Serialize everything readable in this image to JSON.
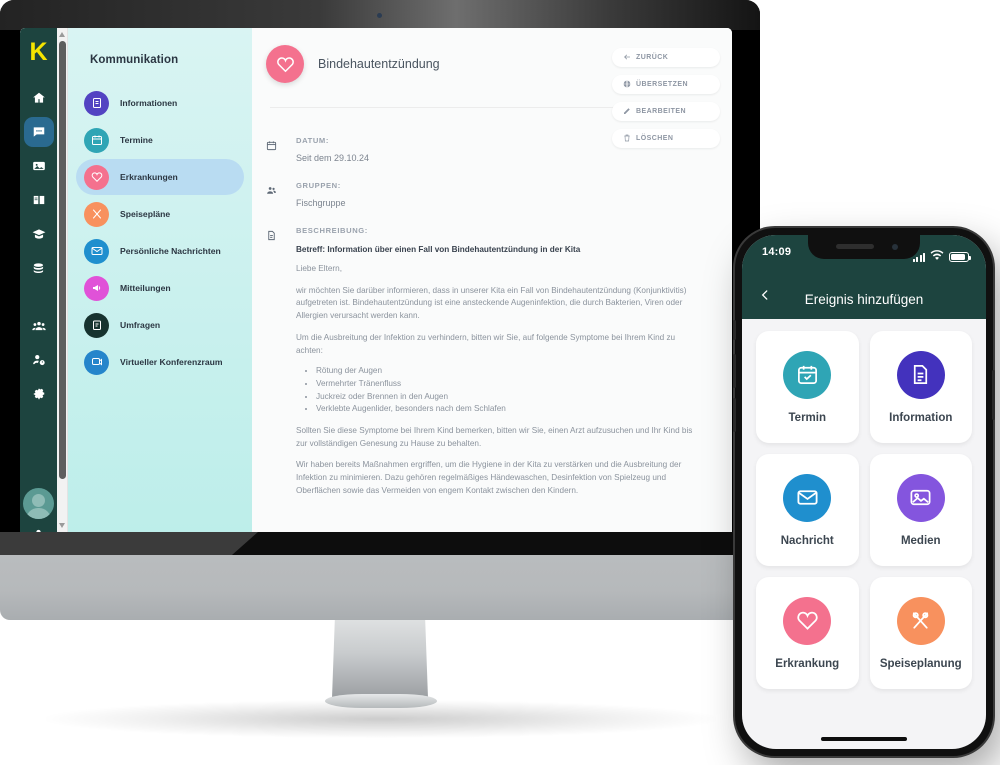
{
  "desktop": {
    "brand_letter": "K",
    "rail_items": [
      {
        "name": "home",
        "icon": "home-icon",
        "active": false
      },
      {
        "name": "communication",
        "icon": "chat-icon",
        "active": true
      },
      {
        "name": "media",
        "icon": "image-icon",
        "active": false
      },
      {
        "name": "documentation",
        "icon": "book-icon",
        "active": false
      },
      {
        "name": "education",
        "icon": "graduation-cap-icon",
        "active": false
      },
      {
        "name": "finance",
        "icon": "coins-icon",
        "active": false
      },
      {
        "name": "groups",
        "icon": "users-icon",
        "active": false
      },
      {
        "name": "staff",
        "icon": "user-clock-icon",
        "active": false
      },
      {
        "name": "settings",
        "icon": "gear-icon",
        "active": false
      }
    ],
    "rail_bottom_icon": "user-icon",
    "menu": {
      "title": "Kommunikation",
      "items": [
        {
          "label": "Informationen",
          "icon": "document-icon",
          "color": "#5243c2",
          "active": false
        },
        {
          "label": "Termine",
          "icon": "calendar-icon",
          "color": "#2fa5b5",
          "active": false
        },
        {
          "label": "Erkrankungen",
          "icon": "heart-pulse-icon",
          "color": "#f4718e",
          "active": true
        },
        {
          "label": "Speisepläne",
          "icon": "cutlery-icon",
          "color": "#f8915e",
          "active": false
        },
        {
          "label": "Persönliche Nachrichten",
          "icon": "envelope-icon",
          "color": "#1f8fce",
          "active": false
        },
        {
          "label": "Mitteilungen",
          "icon": "megaphone-icon",
          "color": "#e052d8",
          "active": false
        },
        {
          "label": "Umfragen",
          "icon": "clipboard-icon",
          "color": "#17332f",
          "active": false
        },
        {
          "label": "Virtueller Konferenzraum",
          "icon": "video-icon",
          "color": "#2585cb",
          "active": false
        }
      ]
    },
    "header": {
      "icon": "heart-pulse-icon",
      "badge_color": "#f4718e",
      "title": "Bindehautentzündung"
    },
    "actions": [
      {
        "label": "ZURÜCK",
        "icon": "arrow-left-icon"
      },
      {
        "label": "ÜBERSETZEN",
        "icon": "globe-icon"
      },
      {
        "label": "BEARBEITEN",
        "icon": "pencil-icon"
      },
      {
        "label": "LÖSCHEN",
        "icon": "trash-icon"
      }
    ],
    "details": [
      {
        "icon": "calendar-icon",
        "label": "DATUM:",
        "value": "Seit dem 29.10.24"
      },
      {
        "icon": "users-icon",
        "label": "GRUPPEN:",
        "value": "Fischgruppe"
      }
    ],
    "description": {
      "icon": "document-icon",
      "label": "BESCHREIBUNG:",
      "subject": "Betreff: Information über einen Fall von Bindehautentzündung in der Kita",
      "salutation": "Liebe Eltern,",
      "paragraph1": "wir möchten Sie darüber informieren, dass in unserer Kita ein Fall von Bindehautentzündung (Konjunktivitis) aufgetreten ist. Bindehautentzündung ist eine ansteckende Augeninfektion, die durch Bakterien, Viren oder Allergien verursacht werden kann.",
      "paragraph2": "Um die Ausbreitung der Infektion zu verhindern, bitten wir Sie, auf folgende Symptome bei Ihrem Kind zu achten:",
      "symptoms": [
        "Rötung der Augen",
        "Vermehrter Tränenfluss",
        "Juckreiz oder Brennen in den Augen",
        "Verklebte Augenlider, besonders nach dem Schlafen"
      ],
      "paragraph3": "Sollten Sie diese Symptome bei Ihrem Kind bemerken, bitten wir Sie, einen Arzt aufzusuchen und Ihr Kind bis zur vollständigen Genesung zu Hause zu behalten.",
      "paragraph4": "Wir haben bereits Maßnahmen ergriffen, um die Hygiene in der Kita zu verstärken und die Ausbreitung der Infektion zu minimieren. Dazu gehören regelmäßiges Händewaschen, Desinfektion von Spielzeug und Oberflächen sowie das Vermeiden von engem Kontakt zwischen den Kindern."
    }
  },
  "phone": {
    "status": {
      "time": "14:09",
      "signal_icon": "signal-bars-icon",
      "wifi_icon": "wifi-icon",
      "battery_icon": "battery-icon"
    },
    "navbar": {
      "back_icon": "chevron-left-icon",
      "title": "Ereignis hinzufügen"
    },
    "tiles": [
      {
        "label": "Termin",
        "icon": "calendar-icon",
        "color": "#2fa5b5"
      },
      {
        "label": "Information",
        "icon": "document-icon",
        "color": "#4332bd"
      },
      {
        "label": "Nachricht",
        "icon": "envelope-icon",
        "color": "#1f8fce"
      },
      {
        "label": "Medien",
        "icon": "image-icon",
        "color": "#8455de"
      },
      {
        "label": "Erkrankung",
        "icon": "heart-pulse-icon",
        "color": "#f4718e"
      },
      {
        "label": "Speiseplanung",
        "icon": "cutlery-icon",
        "color": "#f8915e"
      }
    ]
  },
  "colors": {
    "dark_teal": "#1d443f",
    "mint": "#bdeeea",
    "accent_pink": "#f4718e",
    "brand_yellow": "#f5e400"
  }
}
